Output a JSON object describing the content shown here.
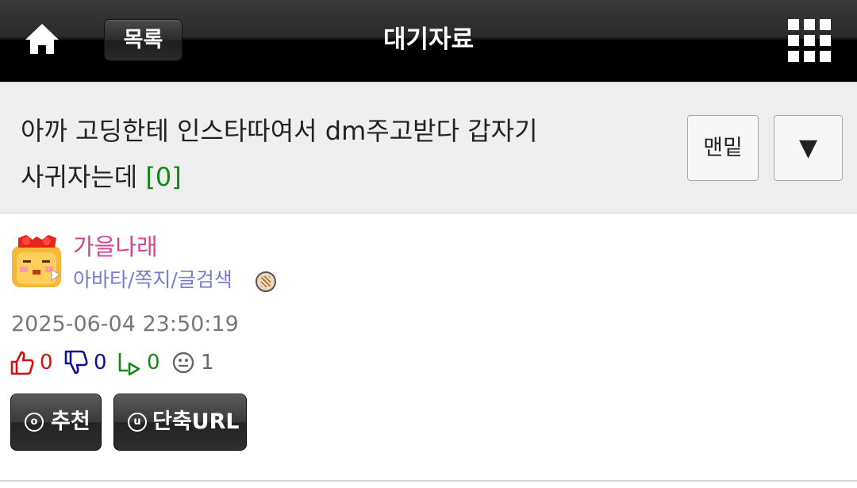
{
  "header": {
    "home_icon": "home-icon",
    "list_label": "목록",
    "title": "대기자료",
    "menu_icon": "grid-menu-icon"
  },
  "post": {
    "title": "아까 고딩한테 인스타따여서 dm주고받다 갑자기 사귀자는데",
    "comment_count": "[0]",
    "scroll_bottom_label": "맨밑",
    "scroll_down_label": "▼"
  },
  "author": {
    "name": "가을나래",
    "links": "아바타/쪽지/글검색",
    "avatar_icon": "bear-avatar-icon",
    "badge_icon": "level-badge-icon"
  },
  "meta": {
    "date": "2025-06-04 23:50:19",
    "likes": "0",
    "dislikes": "0",
    "shares": "0",
    "views": "1"
  },
  "actions": {
    "recommend_label": "추천",
    "short_url_label": "단축URL",
    "recommend_icon_char": "o",
    "short_url_icon_char": "u"
  },
  "colors": {
    "author_name": "#d3448f",
    "author_links": "#7a7ad1",
    "comment_count": "#118a11",
    "like": "#d01010",
    "dislike": "#10109a",
    "share": "#118a11",
    "view": "#666666"
  }
}
